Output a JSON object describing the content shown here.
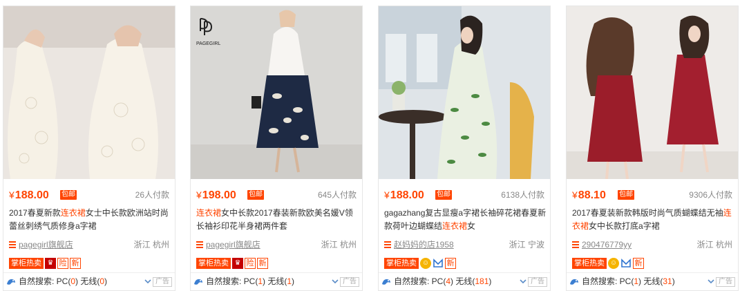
{
  "colors": {
    "accent": "#ff4400",
    "muted": "#888888"
  },
  "products": [
    {
      "currency": "¥",
      "price": "188.00",
      "shipping_badge": "包邮",
      "deal_count": "26人付款",
      "title_parts": [
        "2017春夏新款",
        "连衣裙",
        "女士中长款欧洲站时尚蕾丝刺绣气质修身a字裙"
      ],
      "shop_name": "pagegirl旗舰店",
      "location": "浙江 杭州",
      "badges": {
        "zhanggui": "掌柜热卖",
        "xian": "险",
        "xin": "新"
      },
      "search": {
        "prefix": "自然搜索: PC(",
        "pc": "0",
        "mid": ") 无线(",
        "wireless": "0",
        "suffix": ")"
      },
      "ad_label": "广告"
    },
    {
      "currency": "¥",
      "price": "198.00",
      "shipping_badge": "包邮",
      "deal_count": "645人付款",
      "title_parts": [
        "",
        "连衣裙",
        "女中长款2017春装新款欧美名媛V领长袖衫印花半身裙两件套"
      ],
      "shop_name": "pagegirl旗舰店",
      "location": "浙江 杭州",
      "brand_logo": "PAGEGIRL",
      "badges": {
        "zhanggui": "掌柜热卖",
        "xian": "险",
        "xin": "新"
      },
      "search": {
        "prefix": "自然搜索: PC(",
        "pc": "1",
        "mid": ") 无线(",
        "wireless": "1",
        "suffix": ")"
      },
      "ad_label": "广告"
    },
    {
      "currency": "¥",
      "price": "188.00",
      "shipping_badge": "包邮",
      "deal_count": "6138人付款",
      "title_parts": [
        "gagazhang复古显瘦a字裙长袖碎花裙春夏新款荷叶边蝴蝶结",
        "连衣裙",
        "女"
      ],
      "shop_name": "赵妈妈的店1958",
      "location": "浙江 宁波",
      "badges": {
        "zhanggui": "掌柜热卖",
        "xin": "新"
      },
      "search": {
        "prefix": "自然搜索: PC(",
        "pc": "4",
        "mid": ") 无线(",
        "wireless": "181",
        "suffix": ")"
      },
      "ad_label": "广告"
    },
    {
      "currency": "¥",
      "price": "88.10",
      "shipping_badge": "包邮",
      "deal_count": "9306人付款",
      "title_parts": [
        "2017春夏装新款韩版时尚气质蝴蝶结无袖",
        "连衣裙",
        "女中长款打底a字裙"
      ],
      "shop_name": "290476779yy",
      "location": "浙江 杭州",
      "badges": {
        "zhanggui": "掌柜热卖",
        "xin": "新"
      },
      "search": {
        "prefix": "自然搜索: PC(",
        "pc": "1",
        "mid": ") 无线(",
        "wireless": "31",
        "suffix": ")"
      },
      "ad_label": "广告"
    }
  ]
}
